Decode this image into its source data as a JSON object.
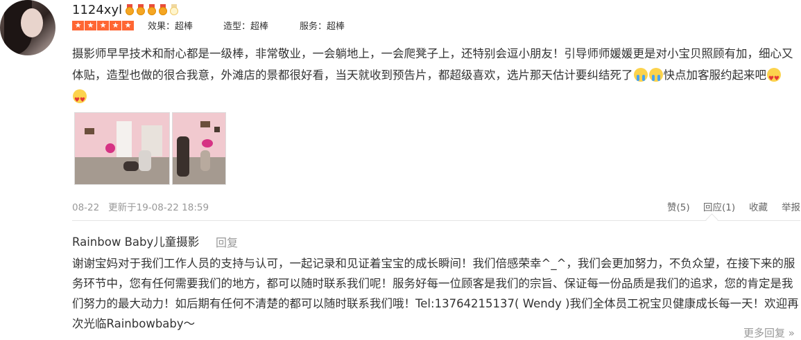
{
  "review": {
    "username": "1124xyl",
    "medal_count": 5,
    "medal_filled": 4,
    "rating": 5,
    "scores": [
      {
        "label": "效果：超棒"
      },
      {
        "label": "造型：超棒"
      },
      {
        "label": "服务：超棒"
      }
    ],
    "text_part1": "摄影师早早技术和耐心都是一级棒，非常敬业，一会躺地上，一会爬凳子上，还特别会逗小朋友！引导师师媛媛更是对小宝贝照顾有加，细心又体贴，造型也做的很合我意，外滩店的景都很好看，当天就收到预告片，都超级喜欢，选片那天估计要纠结死了",
    "text_part2": "快点加客服约起来吧",
    "emoji_names": [
      "crying-face-icon",
      "crying-face-icon",
      "heart-eyes-icon",
      "heart-eyes-icon"
    ],
    "date": "08-22",
    "updated": "更新于19-08-22 18:59",
    "actions": {
      "like": "赞(5)",
      "reply": "回应(1)",
      "collect": "收藏",
      "report": "举报"
    }
  },
  "reply": {
    "author": "Rainbow Baby儿童摄影",
    "reply_label": "回复",
    "text": "谢谢宝妈对于我们工作人员的支持与认可，一起记录和见证着宝宝的成长瞬间！我们倍感荣幸^_^，我们会更加努力，不负众望，在接下来的服务环节中，您有任何需要我们的地方，都可以随时联系我们呢！服务好每一位顾客是我们的宗旨、保证每一份品质是我们的追求，您的肯定是我们努力的最大动力！如后期有任何不清楚的都可以随时联系我们哦！Tel:13764215137( Wendy )我们全体员工祝宝贝健康成长每一天！欢迎再次光临Rainbowbaby～",
    "more": "更多回复 »"
  },
  "colors": {
    "star": "#ff6633",
    "medal": "#f5a623",
    "muted": "#999999"
  }
}
